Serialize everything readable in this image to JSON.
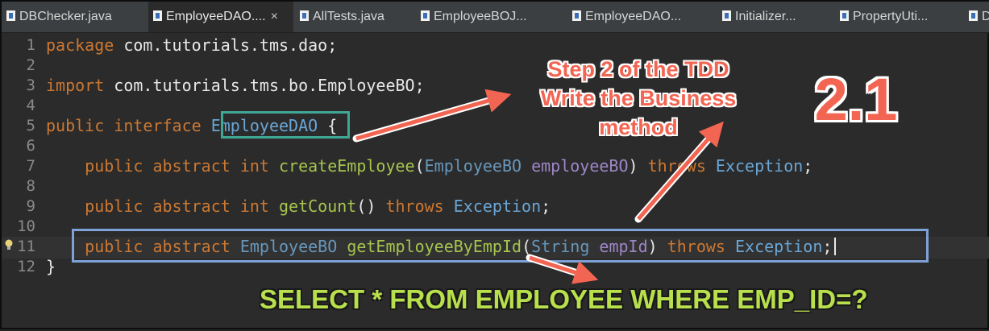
{
  "tabs": [
    {
      "label": "DBChecker.java",
      "active": false,
      "closable": false
    },
    {
      "label": "EmployeeDAO....",
      "active": true,
      "closable": true
    },
    {
      "label": "AllTests.java",
      "active": false,
      "closable": false
    },
    {
      "label": "EmployeeBOJ...",
      "active": false,
      "closable": false
    },
    {
      "label": "EmployeeDAO...",
      "active": false,
      "closable": false
    },
    {
      "label": "Initializer...",
      "active": false,
      "closable": false
    },
    {
      "label": "PropertyUti...",
      "active": false,
      "closable": false
    },
    {
      "label": "D",
      "active": false,
      "closable": false
    }
  ],
  "tab_close_glyph": "×",
  "line_numbers": [
    "1",
    "2",
    "3",
    "4",
    "5",
    "6",
    "7",
    "8",
    "9",
    "10",
    "11",
    "12"
  ],
  "code": {
    "l1_kw": "package",
    "l1_rest": " com.tutorials.tms.dao;",
    "l3_kw": "import",
    "l3_rest": " com.tutorials.tms.bo.EmployeeBO;",
    "l5_kw1": "public",
    "l5_kw2": "interface",
    "l5_name": "EmployeeDAO",
    "l5_brace": " {",
    "l7_mods": "public abstract int",
    "l7_fn": "createEmployee",
    "l7_open": "(",
    "l7_type": "EmployeeBO",
    "l7_param": "employeeBO",
    "l7_close": ")",
    "l7_throws": "throws",
    "l7_ex": "Exception",
    "l7_end": ";",
    "l9_mods": "public abstract int",
    "l9_fn": "getCount",
    "l9_parens": "()",
    "l9_throws": "throws",
    "l9_ex": "Exception",
    "l9_end": ";",
    "l11_mods": "public abstract",
    "l11_ret": "EmployeeBO",
    "l11_fn": "getEmployeeByEmpId",
    "l11_open": "(",
    "l11_type": "String",
    "l11_param": "empId",
    "l11_close": ")",
    "l11_throws": "throws",
    "l11_ex": "Exception",
    "l11_end": ";",
    "l12_brace": "}"
  },
  "annotations": {
    "step_line1": "Step 2 of the TDD",
    "step_line2": "Write the Business",
    "step_line3": "method",
    "number": "2.1",
    "sql": "SELECT * FROM EMPLOYEE WHERE EMP_ID=?"
  },
  "colors": {
    "annotation_red": "#f26552",
    "annotation_green": "#b8e04c",
    "box_teal": "#3fa796",
    "box_blue": "#7ea1d8"
  },
  "icons": [
    "java-file-icon",
    "close-icon",
    "lightbulb-icon",
    "arrow-icon"
  ]
}
